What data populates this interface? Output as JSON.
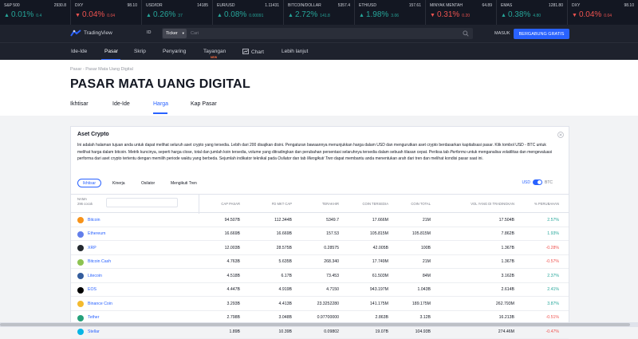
{
  "ticker": [
    {
      "symbol": "S&P 500",
      "price": "2930.8",
      "change": "0.01%",
      "abs": "0.4",
      "dir": "up"
    },
    {
      "symbol": "DXY",
      "price": "98.10",
      "change": "0.04%",
      "abs": "0.04",
      "dir": "down"
    },
    {
      "symbol": "USD/IDR",
      "price": "14185",
      "change": "0.26%",
      "abs": "37",
      "dir": "up"
    },
    {
      "symbol": "EUR/USD",
      "price": "1.11431",
      "change": "0.08%",
      "abs": "0.00091",
      "dir": "up"
    },
    {
      "symbol": "BITCOIN/DOLLAR",
      "price": "5357.4",
      "change": "2.72%",
      "abs": "141.8",
      "dir": "up"
    },
    {
      "symbol": "ETH/USD",
      "price": "157.61",
      "change": "1.98%",
      "abs": "3.06",
      "dir": "up"
    },
    {
      "symbol": "MINYAK MENTAH",
      "price": "64.89",
      "change": "0.31%",
      "abs": "0.20",
      "dir": "down"
    },
    {
      "symbol": "EMAS",
      "price": "1281.80",
      "change": "0.38%",
      "abs": "4.80",
      "dir": "up"
    },
    {
      "symbol": "DXY",
      "price": "98.10",
      "change": "0.04%",
      "abs": "0.04",
      "dir": "down"
    }
  ],
  "colors": {
    "up": "#26a69a",
    "down": "#ef5350",
    "accent": "#2962ff",
    "header": "#1e222d"
  },
  "header": {
    "logo": "TradingView",
    "lang": "ID",
    "ticker_label": "Ticker",
    "search_placeholder": "Cari",
    "login": "MASUK",
    "join": "BERGABUNG GRATIS"
  },
  "nav": {
    "items": [
      "Ide-Ide",
      "Pasar",
      "Skrip",
      "Penyaring",
      "Tayangan",
      "Chart",
      "Lebih lanjut"
    ],
    "new_badge": "NEW",
    "active": "Pasar"
  },
  "page": {
    "breadcrumb": "Pasar - Pasar Mata Uang Digital",
    "title": "PASAR MATA UANG DIGITAL",
    "subtabs": [
      "Ikhtisar",
      "Ide-Ide",
      "Harga",
      "Kap Pasar"
    ],
    "active_subtab": "Harga"
  },
  "card": {
    "title": "Aset Crypto",
    "desc_1": "Ini adalah halaman tujuan anda untuk dapat melihat seluruh aset crypto yang tersedia. Lebih dari 200 disajikan disini. Pengaturan bawaannya menunjukkan harga dalam USD dan mengurutkan aset crypto berdasarkan kapitalisasi pasar. Klik tombol USD - BTC untuk melihat harga dalam bitcoin. Metrik kuncinya, seperti harga close, total dan jumlah koin tersedia, volume yang ditradingkan dan perubahan persentasi selaruhnya tersedia dalam sebuah tilasan cepat. Periksa tab ",
    "desc_em1": "Performo",
    "desc_2": " untuk menganalisa volatilitas dan mengevaluasi performa dari aset crypto tertentu dengan memilih periode waktu yang berbeda. Sejumlah indikator teknikal pada ",
    "desc_em2": "Osilator",
    "desc_3": " dan tab ",
    "desc_em3": "Mengikuti Tren",
    "desc_4": " dapat membantu anda menentukan arah dari tren dan melihat kondisi pasar saat ini.",
    "tabs": [
      "Ikhtisar",
      "Kinerja",
      "Osilator",
      "Mengikuti Tren"
    ],
    "currency_left": "USD",
    "currency_right": "BTC"
  },
  "table": {
    "name_header": "NAMA",
    "count": "296 cocok",
    "headers": [
      "CAP PASAR",
      "FD MKT CAP",
      "TERAKHIR",
      "COIN TERSEDIA",
      "COIN TOTAL",
      "VOL YANG DI TRADINGKAN",
      "% PERUBAHAN"
    ],
    "rows": [
      {
        "name": "Bitcoin",
        "color": "#f7931a",
        "cap": "94.507B",
        "fd": "112.344B",
        "last": "5349.7",
        "avail": "17.666M",
        "total": "21M",
        "vol": "17.504B",
        "chg": "2.57%",
        "dir": "up"
      },
      {
        "name": "Ethereum",
        "color": "#627eea",
        "cap": "16.669B",
        "fd": "16.669B",
        "last": "157.53",
        "avail": "105.815M",
        "total": "105.815M",
        "vol": "7.862B",
        "chg": "1.93%",
        "dir": "up"
      },
      {
        "name": "XRP",
        "color": "#23292f",
        "cap": "12.003B",
        "fd": "28.575B",
        "last": "0.28575",
        "avail": "42.005B",
        "total": "100B",
        "vol": "1.367B",
        "chg": "-0.28%",
        "dir": "down"
      },
      {
        "name": "Bitcoin Cash",
        "color": "#8dc351",
        "cap": "4.763B",
        "fd": "5.635B",
        "last": "268.340",
        "avail": "17.749M",
        "total": "21M",
        "vol": "1.367B",
        "chg": "-0.57%",
        "dir": "down"
      },
      {
        "name": "Litecoin",
        "color": "#345d9d",
        "cap": "4.518B",
        "fd": "6.17B",
        "last": "73.453",
        "avail": "61.503M",
        "total": "84M",
        "vol": "3.162B",
        "chg": "2.37%",
        "dir": "up"
      },
      {
        "name": "EOS",
        "color": "#000000",
        "cap": "4.447B",
        "fd": "4.919B",
        "last": "4.7150",
        "avail": "943.197M",
        "total": "1.043B",
        "vol": "2.614B",
        "chg": "2.41%",
        "dir": "up"
      },
      {
        "name": "Binance Coin",
        "color": "#f3ba2f",
        "cap": "3.293B",
        "fd": "4.413B",
        "last": "23.3252280",
        "avail": "141.175M",
        "total": "189.175M",
        "vol": "262.793M",
        "chg": "3.87%",
        "dir": "up"
      },
      {
        "name": "Tether",
        "color": "#26a17b",
        "cap": "2.798B",
        "fd": "3.048B",
        "last": "0.97700000",
        "avail": "2.863B",
        "total": "3.12B",
        "vol": "16.213B",
        "chg": "-0.51%",
        "dir": "down"
      },
      {
        "name": "Stellar",
        "color": "#08b5e5",
        "cap": "1.89B",
        "fd": "10.39B",
        "last": "0.09802",
        "avail": "19.07B",
        "total": "104.93B",
        "vol": "274.46M",
        "chg": "-0.47%",
        "dir": "down"
      }
    ]
  }
}
